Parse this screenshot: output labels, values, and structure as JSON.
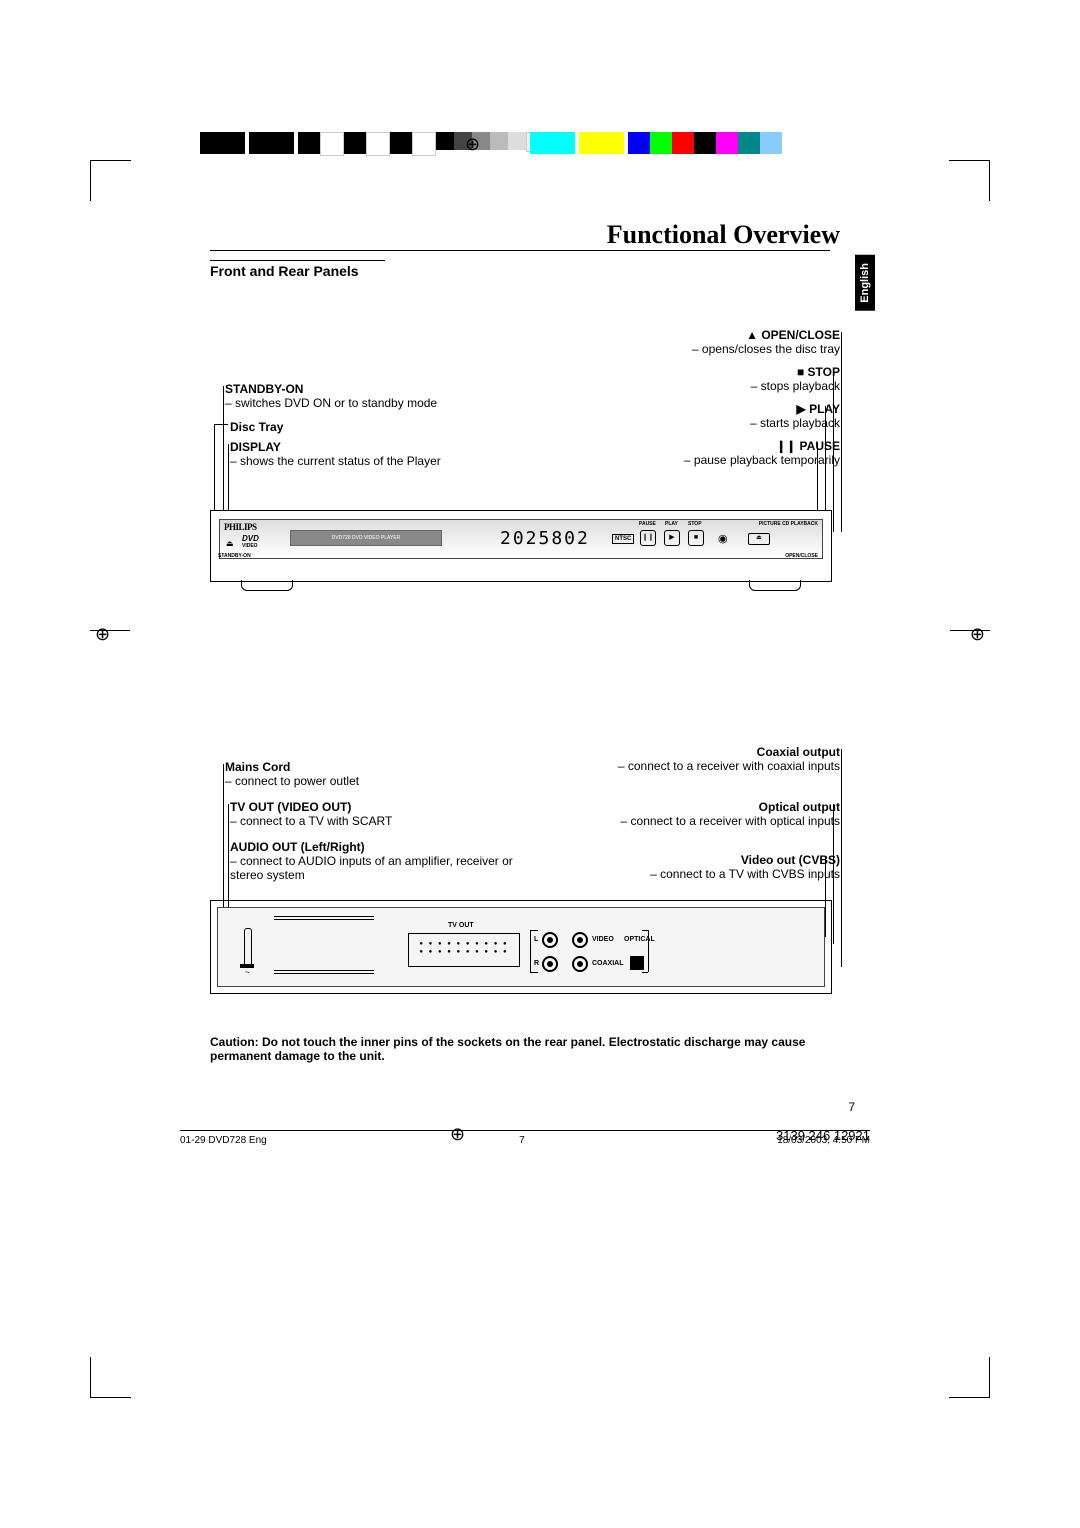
{
  "title": "Functional Overview",
  "language_tab": "English",
  "subsection": "Front and Rear Panels",
  "front_callouts": {
    "open_close": {
      "label": "▲ OPEN/CLOSE",
      "desc": "– opens/closes the disc tray"
    },
    "stop": {
      "label": "■ STOP",
      "desc": "– stops playback"
    },
    "play": {
      "label": "▶ PLAY",
      "desc": "– starts playback"
    },
    "pause": {
      "label": "❙❙ PAUSE",
      "desc": "– pause playback temporarily"
    },
    "standby": {
      "label": "STANDBY-ON",
      "desc": "– switches DVD ON or to standby mode"
    },
    "disc_tray": {
      "label": "Disc Tray",
      "desc": ""
    },
    "display": {
      "label": "DISPLAY",
      "desc": "– shows the current status of the Player"
    }
  },
  "display_value": "2025802",
  "device_model_label": "DVD728 DVD VIDEO PLAYER",
  "rear_callouts": {
    "mains": {
      "label": "Mains Cord",
      "desc": "– connect to power outlet"
    },
    "tvout": {
      "label": "TV OUT (VIDEO OUT)",
      "desc": "– connect to a TV with SCART"
    },
    "audio": {
      "label": "AUDIO OUT (Left/Right)",
      "desc": "– connect to AUDIO inputs of an amplifier, receiver or stereo system"
    },
    "coaxial": {
      "label": "Coaxial output",
      "desc": "– connect to a receiver with coaxial inputs"
    },
    "optical": {
      "label": "Optical output",
      "desc": "– connect to a receiver with optical inputs"
    },
    "cvbs": {
      "label": "Video out (CVBS)",
      "desc": "– connect to a TV with CVBS inputs"
    }
  },
  "rear_labels": {
    "tvout": "TV OUT",
    "video": "VIDEO",
    "optical": "OPTICAL",
    "coaxial": "COAXIAL",
    "l": "L",
    "r": "R"
  },
  "front_labels": {
    "standby": "STANDBY-ON",
    "openclose": "OPEN/CLOSE",
    "pause": "PAUSE",
    "play": "PLAY",
    "stop": "STOP",
    "picturecd": "PICTURE CD PLAYBACK",
    "video": "VIDEO",
    "dvd": "DVD"
  },
  "caution": "Caution: Do not touch the inner pins of the sockets on the rear panel. Electrostatic discharge may cause permanent damage to the unit.",
  "page_number": "7",
  "footer": {
    "left": "01-29 DVD728 Eng",
    "center": "7",
    "right": "18/03/2003, 4:50 PM"
  },
  "doc_code": "3139 246 12921"
}
